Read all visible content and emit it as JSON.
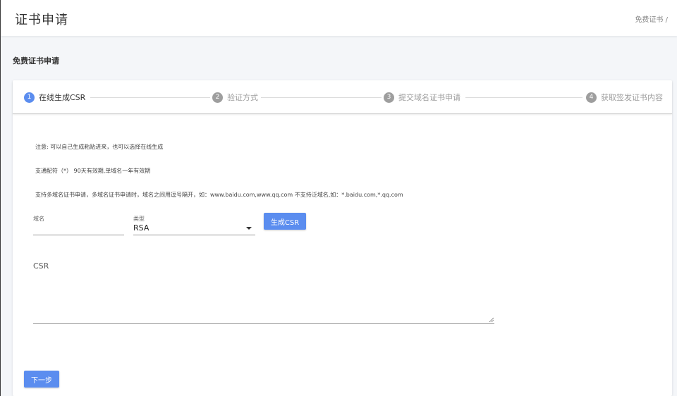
{
  "header": {
    "title": "证书申请",
    "breadcrumb": "免费证书 /"
  },
  "section": {
    "title": "免费证书申请"
  },
  "stepper": {
    "steps": [
      {
        "num": "1",
        "label": "在线生成CSR"
      },
      {
        "num": "2",
        "label": "验证方式"
      },
      {
        "num": "3",
        "label": "提交域名证书申请"
      },
      {
        "num": "4",
        "label": "获取签发证书内容"
      }
    ],
    "active_step": 1
  },
  "notes": {
    "line1": "注意: 可以自己生成粘贴进来，也可以选择在线生成",
    "line2": "支通配符（*） 90天有效期,单域名一年有效期",
    "line3": "支持多域名证书申请，多域名证书申请时，域名之间用逗号隔开，如：www.baidu.com,www.qq.com 不支持泛域名,如：*.baidu.com,*.qq.com"
  },
  "form": {
    "domain_label": "域名",
    "domain_value": "",
    "type_label": "类型",
    "type_value": "RSA",
    "generate_button": "生成CSR",
    "csr_label": "CSR",
    "csr_value": "",
    "next_button": "下一步"
  },
  "colors": {
    "primary": "#5b8def",
    "step_inactive": "#9e9e9e"
  }
}
